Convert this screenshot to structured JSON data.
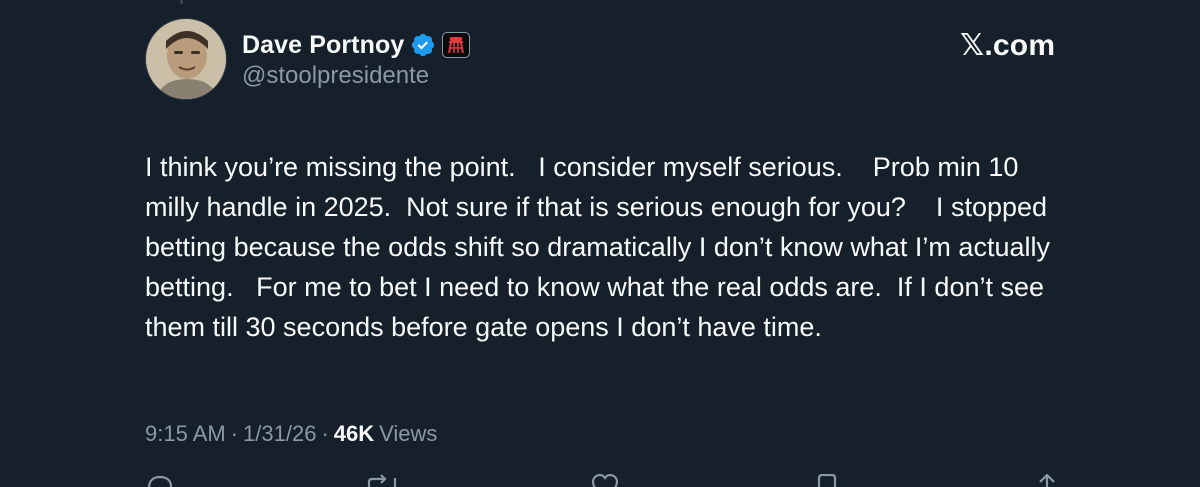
{
  "author": {
    "display_name": "Dave Portnoy",
    "handle": "@stoolpresidente",
    "verified": true,
    "verified_color": "#1d9bf0",
    "affiliate_badge_icon": "barstool-badge-icon"
  },
  "brand": {
    "label": "𝕏.com"
  },
  "tweet": {
    "text": "I think you’re missing the point.   I consider myself serious.    Prob min 10 milly handle in 2025.  Not sure if that is serious enough for you?    I stopped betting because the odds shift so dramatically I don’t know what I’m actually betting.   For me to bet I need to know what the real odds are.  If I don’t see them till 30 seconds before gate opens I don’t have time."
  },
  "meta": {
    "time": "9:15 AM",
    "separator": "·",
    "date": "1/31/26",
    "views_count": "46K",
    "views_label": "Views"
  },
  "actions": [
    {
      "name": "reply-icon"
    },
    {
      "name": "repost-icon"
    },
    {
      "name": "like-icon"
    },
    {
      "name": "bookmark-icon"
    },
    {
      "name": "share-icon"
    }
  ],
  "colors": {
    "background": "#15202b",
    "primary_text": "#f7f9f9",
    "secondary_text": "#8b98a5"
  }
}
